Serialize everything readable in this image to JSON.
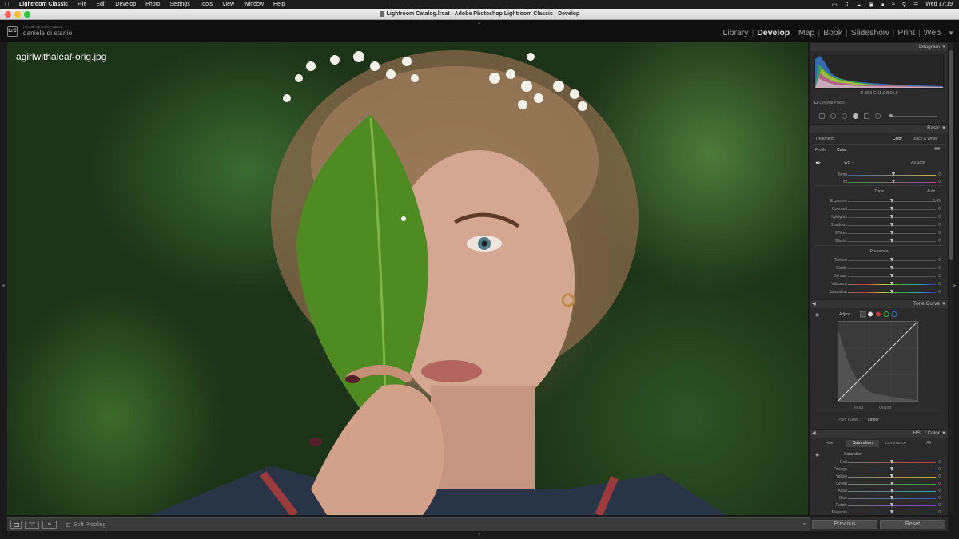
{
  "menubar": {
    "app": "Lightroom Classic",
    "items": [
      "File",
      "Edit",
      "Develop",
      "Photo",
      "Settings",
      "Tools",
      "View",
      "Window",
      "Help"
    ],
    "clock": "Wed 17:19"
  },
  "window": {
    "title": "Lightroom Catalog.lrcat - Adobe Photoshop Lightroom Classic - Develop"
  },
  "identity": {
    "logo": "LrC",
    "subtitle": "Adobe Lightroom Classic",
    "name": "daniele di stanio",
    "modules": [
      "Library",
      "Develop",
      "Map",
      "Book",
      "Slideshow",
      "Print",
      "Web"
    ],
    "active_module": "Develop"
  },
  "photo": {
    "filename": "agirlwithaleaf-orig.jpg"
  },
  "histogram": {
    "header": "Histogram",
    "readout": "R 28,9  G 18,0  B 36,0",
    "original_photo": "Original Photo"
  },
  "basic": {
    "header": "Basic",
    "treatment_label": "Treatment :",
    "treatment_color": "Color",
    "treatment_bw": "Black & White",
    "profile_label": "Profile :",
    "profile_value": "Color",
    "wb_label": "WB :",
    "wb_value": "As Shot",
    "tone_label": "Tone",
    "auto_label": "Auto",
    "presence_label": "Presence",
    "sliders_wb": [
      {
        "label": "Temp",
        "value": "0",
        "pos": 0.52
      },
      {
        "label": "Tint",
        "value": "0",
        "pos": 0.52
      }
    ],
    "sliders_tone": [
      {
        "label": "Exposure",
        "value": "0.00",
        "pos": 0.5
      },
      {
        "label": "Contrast",
        "value": "0",
        "pos": 0.5
      },
      {
        "label": "Highlights",
        "value": "0",
        "pos": 0.5
      },
      {
        "label": "Shadows",
        "value": "0",
        "pos": 0.5
      },
      {
        "label": "Whites",
        "value": "0",
        "pos": 0.5
      },
      {
        "label": "Blacks",
        "value": "0",
        "pos": 0.5
      }
    ],
    "sliders_presence": [
      {
        "label": "Texture",
        "value": "0",
        "pos": 0.5
      },
      {
        "label": "Clarity",
        "value": "0",
        "pos": 0.5
      },
      {
        "label": "Dehaze",
        "value": "0",
        "pos": 0.5
      },
      {
        "label": "Vibrance",
        "value": "0",
        "pos": 0.5
      },
      {
        "label": "Saturation",
        "value": "0",
        "pos": 0.5
      }
    ]
  },
  "tone_curve": {
    "header": "Tone Curve",
    "adjust_label": "Adjust :",
    "input_label": "Input",
    "output_label": "Output",
    "point_curve_label": "Point Curve :",
    "point_curve_value": "Linear"
  },
  "hsl": {
    "header": "HSL / Color",
    "tabs": [
      "Hue",
      "Saturation",
      "Luminance",
      "All"
    ],
    "active_tab": "Saturation",
    "section_label": "Saturation",
    "sliders": [
      {
        "label": "Red",
        "value": "0",
        "color": "#c0392b"
      },
      {
        "label": "Orange",
        "value": "0",
        "color": "#d67a23"
      },
      {
        "label": "Yellow",
        "value": "0",
        "color": "#c9b227"
      },
      {
        "label": "Green",
        "value": "0",
        "color": "#3b9b3b"
      },
      {
        "label": "Aqua",
        "value": "0",
        "color": "#2ea6a6"
      },
      {
        "label": "Blue",
        "value": "0",
        "color": "#2f5fc9"
      },
      {
        "label": "Purple",
        "value": "0",
        "color": "#7b3fc0"
      },
      {
        "label": "Magenta",
        "value": "0",
        "color": "#c03f9f"
      }
    ]
  },
  "toolbar": {
    "soft_proofing": "Soft Proofing"
  },
  "buttons": {
    "previous": "Previous",
    "reset": "Reset"
  },
  "colors": {
    "accent": "#e5e5e5",
    "panel_bg": "#2b2b2b",
    "background": "#1a1a1a"
  }
}
